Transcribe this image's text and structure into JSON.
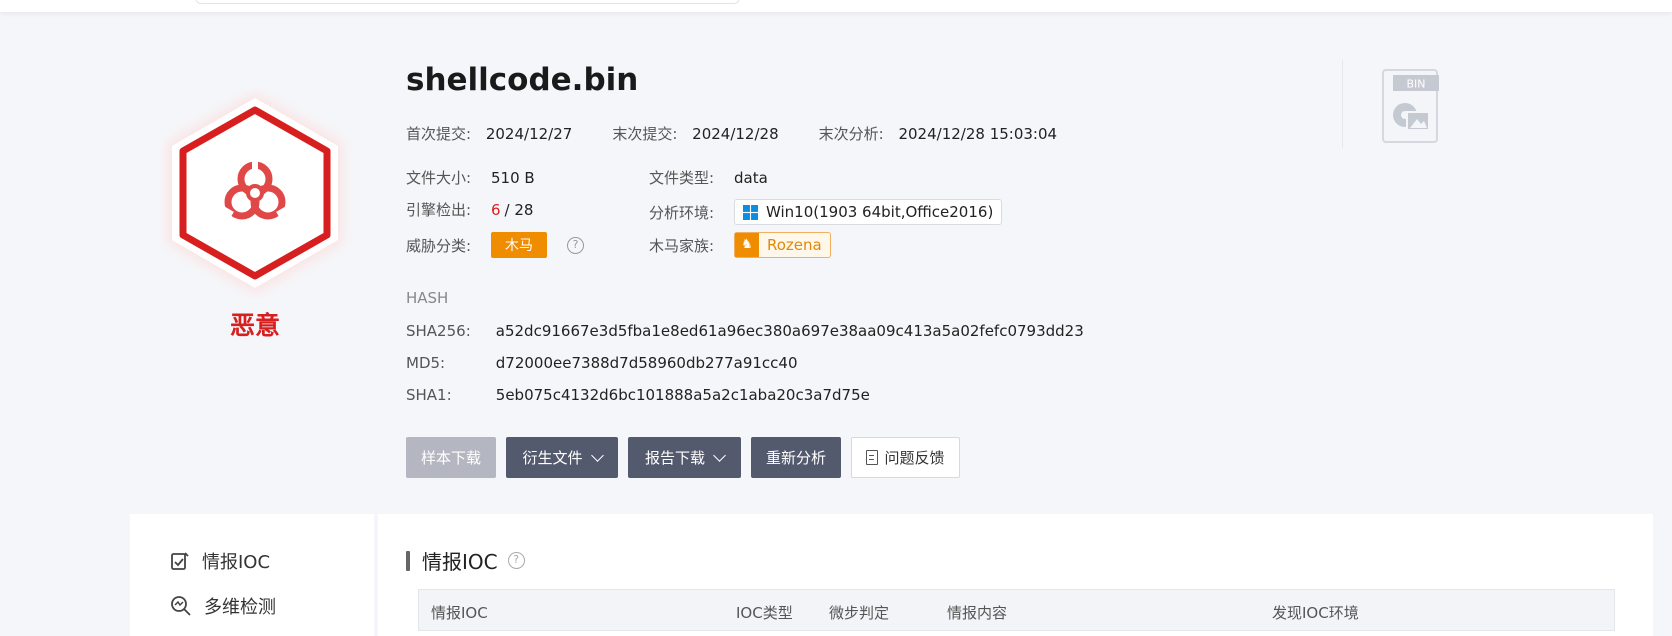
{
  "file": {
    "name": "shellcode.bin",
    "verdict": "恶意",
    "type_badge": "BIN"
  },
  "dates": {
    "first_submit_label": "首次提交:",
    "first_submit": "2024/12/27",
    "last_submit_label": "末次提交:",
    "last_submit": "2024/12/28",
    "last_analysis_label": "末次分析:",
    "last_analysis": "2024/12/28 15:03:04"
  },
  "info": {
    "size_label": "文件大小:",
    "size": "510 B",
    "filetype_label": "文件类型:",
    "filetype": "data",
    "engine_label": "引擎检出:",
    "engine_hits": "6",
    "engine_total": "/ 28",
    "env_label": "分析环境:",
    "env": "Win10(1903 64bit,Office2016)",
    "threat_label": "威胁分类:",
    "threat": "木马",
    "family_label": "木马家族:",
    "family": "Rozena"
  },
  "hash": {
    "title": "HASH",
    "sha256_label": "SHA256:",
    "sha256": "a52dc91667e3d5fba1e8ed61a96ec380a697e38aa09c413a5a02fefc0793dd23",
    "md5_label": "MD5:",
    "md5": "d72000ee7388d7d58960db277a91cc40",
    "sha1_label": "SHA1:",
    "sha1": "5eb075c4132d6bc101888a5a2c1aba20c3a7d75e"
  },
  "actions": {
    "download_sample": "样本下载",
    "derived_files": "衍生文件",
    "report_download": "报告下载",
    "reanalyze": "重新分析",
    "feedback": "问题反馈"
  },
  "sidebar": {
    "items": [
      {
        "label": "情报IOC",
        "icon": "checklist-icon"
      },
      {
        "label": "多维检测",
        "icon": "search-scan-icon"
      }
    ]
  },
  "main": {
    "section_title": "情报IOC",
    "columns": [
      "情报IOC",
      "IOC类型",
      "微步判定",
      "情报内容",
      "发现IOC环境"
    ]
  },
  "colors": {
    "malicious": "#d71f1f",
    "trojan": "#f08c00",
    "button_dark": "#545a6e"
  }
}
